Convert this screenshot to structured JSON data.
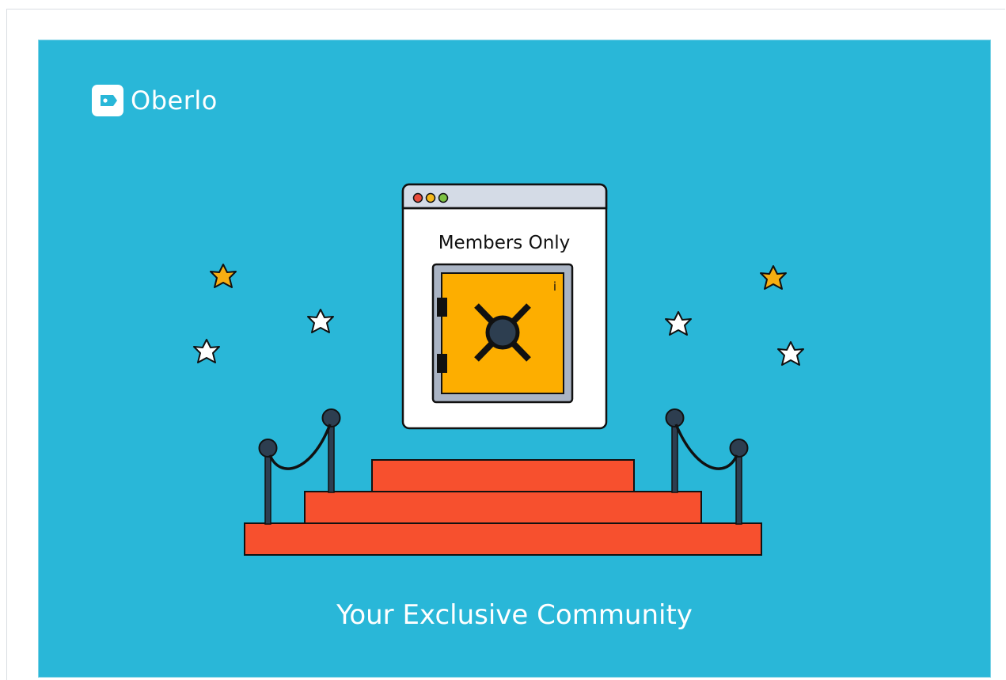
{
  "brand": {
    "name": "Oberlo",
    "logo_icon": "tag-icon"
  },
  "window": {
    "title": "Members Only",
    "traffic_lights": [
      "#e94b3c",
      "#f5b91a",
      "#7cc243"
    ],
    "safe_mark": "i"
  },
  "tagline": "Your Exclusive Community",
  "colors": {
    "background": "#29b7d8",
    "safe": "#fdae00",
    "steps": "#f7502e",
    "star_gold": "#f6ae12",
    "star_white": "#ffffff",
    "posts": "#2d3e50",
    "window_bar": "#d4dbe6"
  },
  "icons": {
    "stars": [
      "star-icon",
      "star-icon",
      "star-icon",
      "star-icon",
      "star-icon",
      "star-icon"
    ],
    "dial": "safe-dial-icon"
  }
}
